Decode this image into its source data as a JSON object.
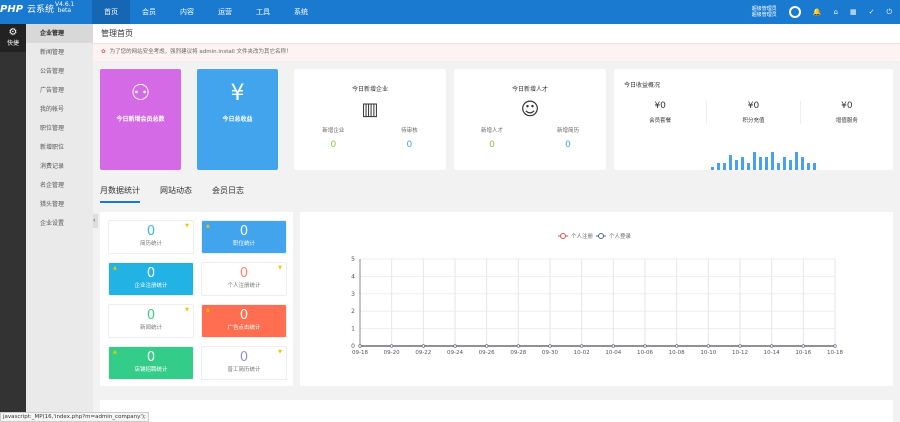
{
  "header": {
    "logo": "PHP",
    "system": "云系统",
    "version": "V4.6.1",
    "beta": "beta",
    "nav": [
      "首页",
      "会员",
      "内容",
      "运营",
      "工具",
      "系统"
    ],
    "admin_line1": "超级管理员",
    "admin_line2": "超级管理员"
  },
  "rail": {
    "label": "快捷"
  },
  "sidebar": [
    "企业管理",
    "新闻管理",
    "公告管理",
    "广告管理",
    "我的帐号",
    "职位管理",
    "新增职位",
    "消费记录",
    "名企管理",
    "猎头管理",
    "企业设置"
  ],
  "breadcrumb": "管理首页",
  "notice": "为了您的网站安全考虑，强烈建议将 admin.install 文件夹改为其它名称！",
  "cards": {
    "members": "今日新增会员总数",
    "income": "今日总收益",
    "company": {
      "title": "今日新增企业",
      "s1": "新增企业",
      "v1": "0",
      "s2": "待审核",
      "v2": "0"
    },
    "talent": {
      "title": "今日新增人才",
      "s1": "新增人才",
      "v1": "0",
      "s2": "新增简历",
      "v2": "0"
    },
    "revenue": {
      "title": "今日收益概况",
      "items": [
        {
          "v": "¥0",
          "l": "会员套餐"
        },
        {
          "v": "¥0",
          "l": "积分充值"
        },
        {
          "v": "¥0",
          "l": "增值服务"
        }
      ]
    }
  },
  "tabs": [
    "月数据统计",
    "网站动态",
    "会员日志"
  ],
  "tiles": [
    {
      "v": "0",
      "l": "简历统计"
    },
    {
      "v": "0",
      "l": "职位统计"
    },
    {
      "v": "0",
      "l": "企业注册统计"
    },
    {
      "v": "0",
      "l": "个人注册统计"
    },
    {
      "v": "0",
      "l": "新闻统计"
    },
    {
      "v": "0",
      "l": "广告点击统计"
    },
    {
      "v": "0",
      "l": "店铺招聘统计"
    },
    {
      "v": "0",
      "l": "普工简历统计"
    }
  ],
  "chart_data": {
    "type": "line",
    "x": [
      "09-18",
      "09-19",
      "09-20",
      "09-21",
      "09-22",
      "09-23",
      "09-24",
      "09-25",
      "09-26",
      "09-27",
      "09-28",
      "09-29",
      "09-30",
      "10-01",
      "10-02",
      "10-03",
      "10-04",
      "10-05",
      "10-06",
      "10-07",
      "10-08",
      "10-09",
      "10-10",
      "10-11",
      "10-12",
      "10-13",
      "10-14",
      "10-15",
      "10-16",
      "10-17",
      "10-18"
    ],
    "xticks": [
      "09-18",
      "09-20",
      "09-22",
      "09-24",
      "09-26",
      "09-28",
      "09-30",
      "10-02",
      "10-04",
      "10-06",
      "10-08",
      "10-10",
      "10-12",
      "10-14",
      "10-16",
      "10-18"
    ],
    "yticks": [
      "0",
      "1",
      "2",
      "3",
      "4",
      "5"
    ],
    "ylim": [
      0,
      5
    ],
    "series": [
      {
        "name": "个人注册",
        "color": "#e05050",
        "values": [
          0,
          0,
          0,
          0,
          0,
          0,
          0,
          0,
          0,
          0,
          0,
          0,
          0,
          0,
          0,
          0,
          0,
          0,
          0,
          0,
          0,
          0,
          0,
          0,
          0,
          0,
          0,
          0,
          0,
          0,
          0
        ]
      },
      {
        "name": "个人登录",
        "color": "#556677",
        "values": [
          0,
          0,
          0,
          0,
          0,
          0,
          0,
          0,
          0,
          0,
          0,
          0,
          0,
          0,
          0,
          0,
          0,
          0,
          0,
          0,
          0,
          0,
          0,
          0,
          0,
          0,
          0,
          0,
          0,
          0,
          0
        ]
      }
    ],
    "legend": "top-center"
  },
  "status_bar": "javascript:_MP(16,'index.php?m=admin_company');"
}
